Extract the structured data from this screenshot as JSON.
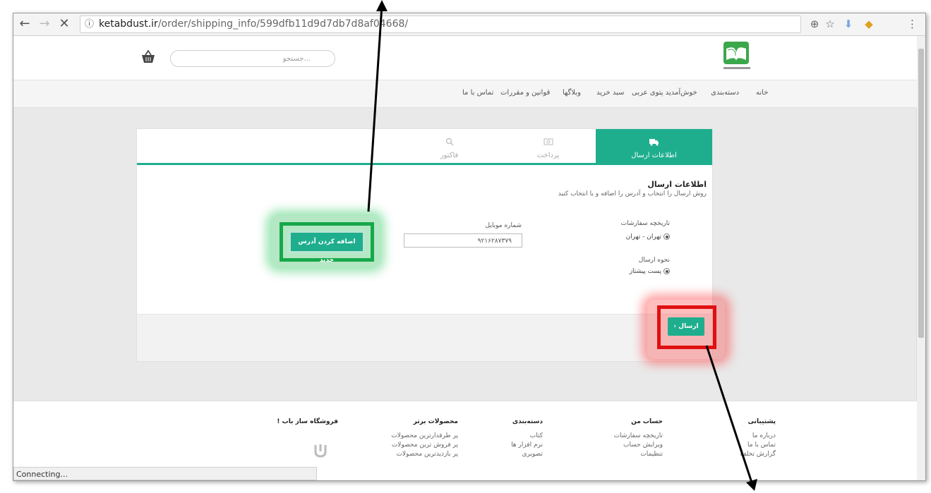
{
  "browser": {
    "url_host": "ketabdust.ir",
    "url_path": "/order/shipping_info/599dfb11d9d7db7d8af04668/",
    "status_text": "Connecting..."
  },
  "header": {
    "search_placeholder": "جستجو..."
  },
  "nav": {
    "items": [
      "خانه",
      "دسته‌بندی",
      "خوش‌آمدید پتوی عربی",
      "سبد خرید",
      "وبلاگها",
      "قوانین و مقررات",
      "تماس با ما"
    ]
  },
  "tabs": [
    {
      "label": "اطلاعات ارسال",
      "icon": "truck-icon",
      "active": true
    },
    {
      "label": "پرداخت",
      "icon": "money-icon",
      "active": false
    },
    {
      "label": "فاکتور",
      "icon": "search-icon",
      "active": false
    }
  ],
  "shipping": {
    "title": "اطلاعات ارسال",
    "subtitle": "روش ارسال را انتخاب و آدرس را اضافه و یا انتخاب کنید",
    "history_label": "تاریخچه سفارشات",
    "history_option": "تهران - تهران",
    "method_label": "نحوه ارسال",
    "method_option": "پست پیشتاز",
    "mobile_label": "شماره موبایل",
    "mobile_value": "۹۲۱۶۲۸۷۳۷۹",
    "add_address_label": "اضافه کردن آدرس جدید",
    "send_label": "ارسال"
  },
  "footer": {
    "columns": [
      {
        "title": "پشتیبانی",
        "links": [
          "درباره ما",
          "تماس با ما",
          "گزارش تخلف"
        ]
      },
      {
        "title": "حساب من",
        "links": [
          "تاریخچه سفارشات",
          "ویرایش حساب",
          "تنظیمات"
        ]
      },
      {
        "title": "دسته‌بندی",
        "links": [
          "کتاب",
          "نرم افزار ها",
          "تصویری"
        ]
      },
      {
        "title": "محصولات برتر",
        "links": [
          "پر طرفدارترین محصولات",
          "پر فروش ترین محصولات",
          "پر بازدیدترین محصولات"
        ]
      },
      {
        "title": "فروشگاه ساز باب !",
        "links": []
      }
    ]
  },
  "colors": {
    "accent": "#1eae8e",
    "highlight_green": "#17a84a",
    "highlight_red": "#e01010"
  }
}
